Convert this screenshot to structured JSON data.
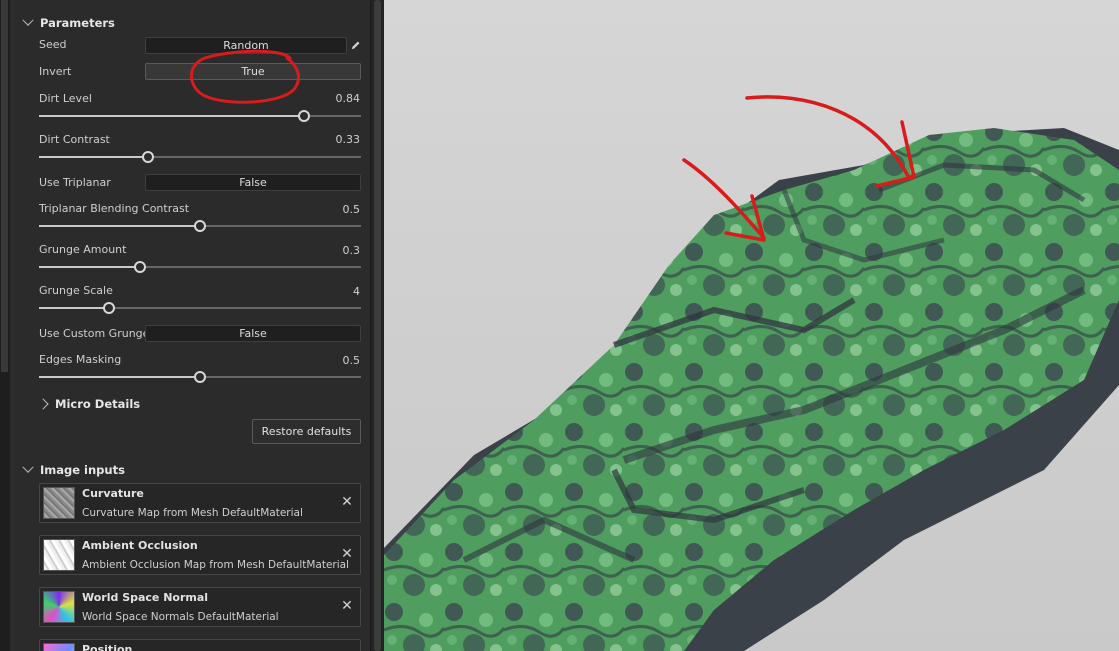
{
  "parameters": {
    "header": "Parameters",
    "seed": {
      "label": "Seed",
      "value": "Random"
    },
    "invert": {
      "label": "Invert",
      "value": "True"
    },
    "dirt_level": {
      "label": "Dirt Level",
      "value": "0.84",
      "fraction": 0.823
    },
    "dirt_contrast": {
      "label": "Dirt Contrast",
      "value": "0.33",
      "fraction": 0.339
    },
    "use_triplanar": {
      "label": "Use Triplanar",
      "value": "False"
    },
    "triplanar_blending": {
      "label": "Triplanar Blending Contrast",
      "value": "0.5",
      "fraction": 0.5
    },
    "grunge_amount": {
      "label": "Grunge Amount",
      "value": "0.3",
      "fraction": 0.314
    },
    "grunge_scale": {
      "label": "Grunge Scale",
      "value": "4",
      "fraction": 0.217
    },
    "use_custom_grunge": {
      "label": "Use Custom Grunge",
      "value": "False"
    },
    "edges_masking": {
      "label": "Edges Masking",
      "value": "0.5",
      "fraction": 0.5
    }
  },
  "micro_details": {
    "header": "Micro Details"
  },
  "restore_defaults": "Restore defaults",
  "image_inputs": {
    "header": "Image inputs",
    "items": [
      {
        "title": "Curvature",
        "subtitle": "Curvature Map from Mesh DefaultMaterial"
      },
      {
        "title": "Ambient Occlusion",
        "subtitle": "Ambient Occlusion Map from Mesh DefaultMaterial"
      },
      {
        "title": "World Space Normal",
        "subtitle": "World Space Normals DefaultMaterial"
      },
      {
        "title": "Position",
        "subtitle": ""
      }
    ]
  },
  "colors": {
    "panel_bg": "#2b2b2b",
    "annotation_red": "#d81b1b",
    "rock_green": "#4a9c5c",
    "rock_dark": "#3a4148"
  }
}
